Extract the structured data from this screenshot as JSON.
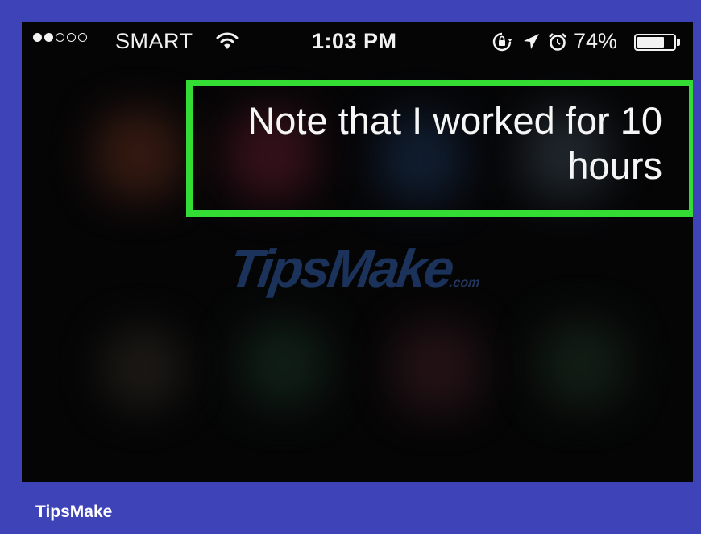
{
  "status_bar": {
    "signal_filled": 2,
    "signal_total": 5,
    "carrier": "SMART",
    "time": "1:03 PM",
    "battery_percent_text": "74%",
    "battery_level": 0.74,
    "icons": [
      "wifi-icon",
      "rotation-lock-icon",
      "location-arrow-icon",
      "alarm-clock-icon",
      "battery-icon"
    ]
  },
  "siri": {
    "request_text": "Note that I worked for 10 hours"
  },
  "highlight": {
    "color": "#33dd33"
  },
  "watermark": {
    "brand_logo": "TipsMake",
    "suffix": ".com"
  },
  "footer": {
    "caption": "TipsMake"
  },
  "colors": {
    "frame": "#3e44b8",
    "screen": "#050506",
    "highlight": "#33dd33"
  }
}
